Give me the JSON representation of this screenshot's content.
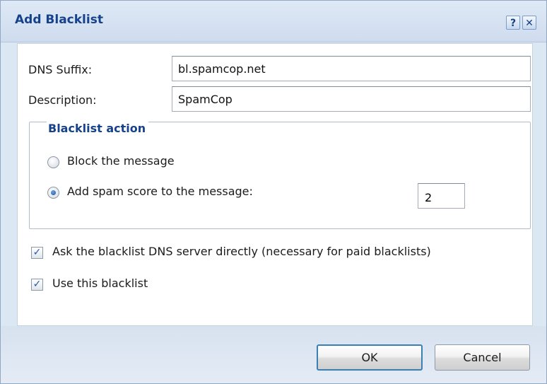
{
  "dialog": {
    "title": "Add Blacklist",
    "help_icon": "?",
    "close_icon": "✕"
  },
  "form": {
    "dns_suffix_label": "DNS Suffix:",
    "dns_suffix_value": "bl.spamcop.net",
    "description_label": "Description:",
    "description_value": "SpamCop",
    "action_group_label": "Blacklist action",
    "radio_block_label": "Block the message",
    "radio_score_label": "Add spam score to the message:",
    "spam_score_value": "2",
    "selected_action": "add-spam-score",
    "check_direct_label": "Ask the blacklist DNS server directly (necessary for paid blacklists)",
    "check_direct_checked": true,
    "check_use_label": "Use this blacklist",
    "check_use_checked": true,
    "check_mark": "✓"
  },
  "buttons": {
    "ok_label": "OK",
    "cancel_label": "Cancel"
  },
  "colors": {
    "title": "#15428b",
    "accent_border": "#3c7fb1"
  }
}
